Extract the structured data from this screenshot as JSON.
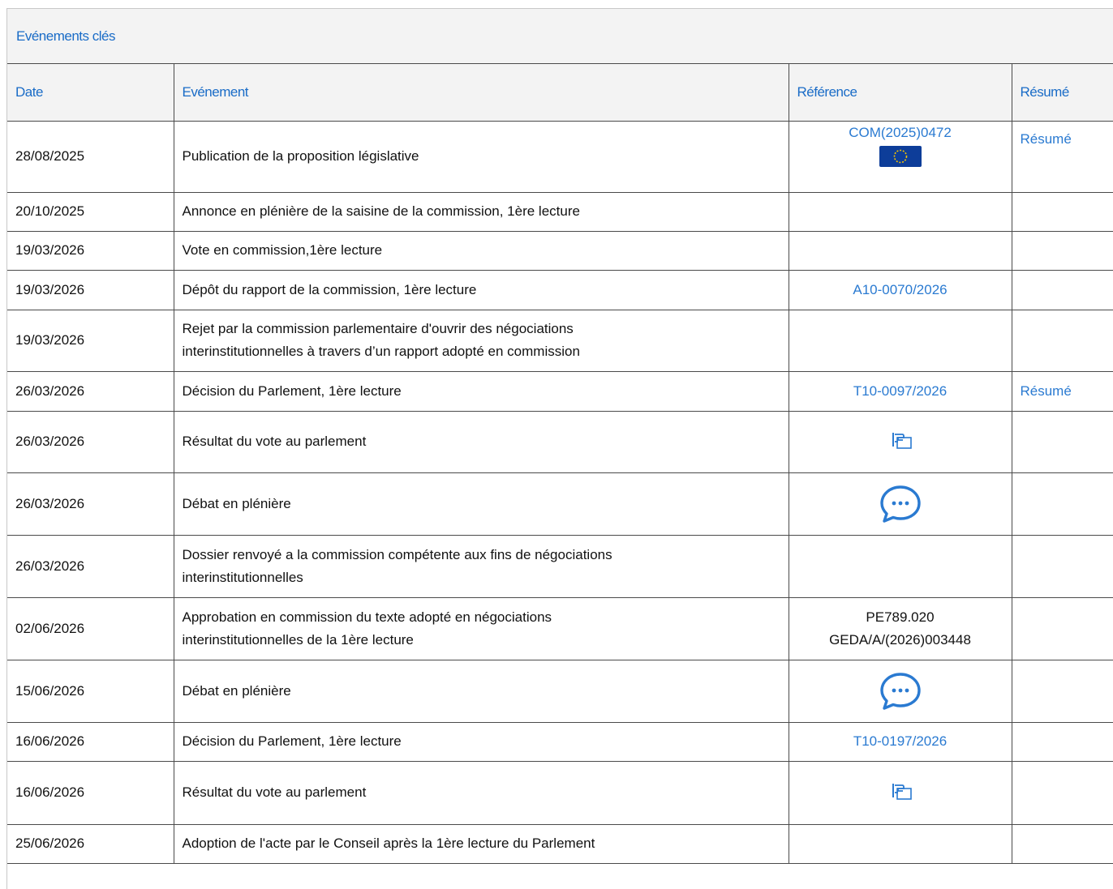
{
  "panel": {
    "title": "Evénements clés"
  },
  "table": {
    "headers": {
      "date": "Date",
      "event": "Evénement",
      "reference": "Référence",
      "summary": "Résumé"
    },
    "rows": [
      {
        "date": "28/08/2025",
        "event": "Publication de la proposition législative",
        "reference": "COM(2025)0472",
        "reference_icon": "eu-flag-icon",
        "summary": "Résumé"
      },
      {
        "date": "20/10/2025",
        "event": "Annonce en plénière de la saisine de la commission, 1ère lecture"
      },
      {
        "date": "19/03/2026",
        "event": "Vote en commission,1ère lecture"
      },
      {
        "date": "19/03/2026",
        "event": "Dépôt du rapport de la commission, 1ère lecture",
        "reference": "A10-0070/2026"
      },
      {
        "date": "19/03/2026",
        "event_line1": "Rejet par la commission parlementaire d'ouvrir des négociations",
        "event_line2": "interinstitutionnelles à travers d’un rapport adopté en commission"
      },
      {
        "date": "26/03/2026",
        "event": "Décision du Parlement, 1ère lecture",
        "reference": "T10-0097/2026",
        "summary": "Résumé"
      },
      {
        "date": "26/03/2026",
        "event": "Résultat du vote au parlement",
        "reference_icon": "vote-result-icon"
      },
      {
        "date": "26/03/2026",
        "event": "Débat en plénière",
        "reference_icon": "debate-speech-bubble-icon"
      },
      {
        "date": "26/03/2026",
        "event_line1": "Dossier renvoyé a la commission compétente aux fins de négociations",
        "event_line2": "interinstitutionnelles"
      },
      {
        "date": "02/06/2026",
        "event_line1": "Approbation en commission du texte adopté en négociations",
        "event_line2": "interinstitutionnelles de la 1ère lecture",
        "reference_line1": "PE789.020",
        "reference_line2": "GEDA/A/(2026)003448"
      },
      {
        "date": "15/06/2026",
        "event": "Débat en plénière",
        "reference_icon": "debate-speech-bubble-icon"
      },
      {
        "date": "16/06/2026",
        "event": "Décision du Parlement, 1ère lecture",
        "reference": "T10-0197/2026"
      },
      {
        "date": "16/06/2026",
        "event": "Résultat du vote au parlement",
        "reference_icon": "vote-result-icon"
      },
      {
        "date": "25/06/2026",
        "event": "Adoption de l'acte par le Conseil après la 1ère lecture du Parlement"
      }
    ]
  },
  "colors": {
    "link": "#2a7ad1",
    "header_text": "#1a6cc7",
    "header_bg": "#f3f3f3",
    "border": "#4a4a4a",
    "eu_blue": "#0d3d99",
    "eu_gold": "#f5c400"
  }
}
